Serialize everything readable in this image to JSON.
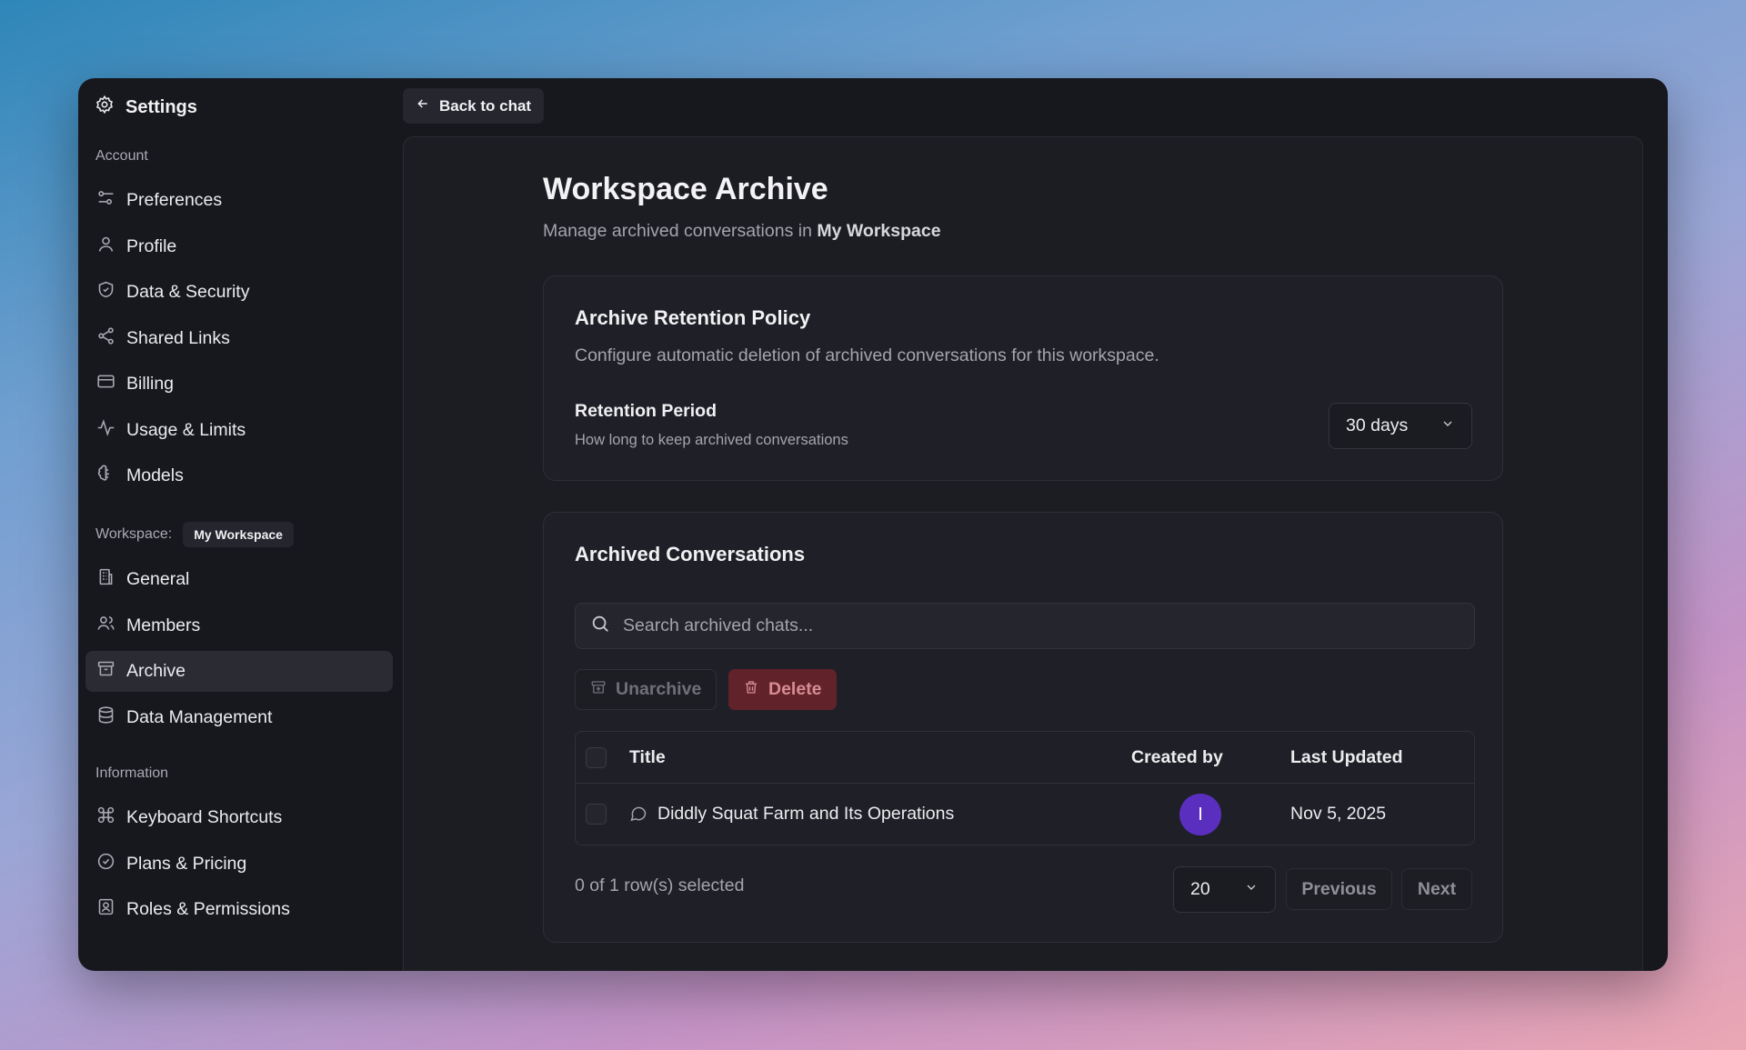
{
  "sidebar": {
    "title": "Settings",
    "sections": {
      "account": "Account",
      "workspace_label": "Workspace:",
      "workspace_badge": "My Workspace",
      "information": "Information"
    },
    "account_items": [
      {
        "label": "Preferences",
        "icon": "sliders-icon"
      },
      {
        "label": "Profile",
        "icon": "user-icon"
      },
      {
        "label": "Data & Security",
        "icon": "shield-icon"
      },
      {
        "label": "Shared Links",
        "icon": "share-icon"
      },
      {
        "label": "Billing",
        "icon": "credit-card-icon"
      },
      {
        "label": "Usage & Limits",
        "icon": "activity-icon"
      },
      {
        "label": "Models",
        "icon": "brain-icon"
      }
    ],
    "workspace_items": [
      {
        "label": "General",
        "icon": "building-icon"
      },
      {
        "label": "Members",
        "icon": "users-icon"
      },
      {
        "label": "Archive",
        "icon": "archive-icon",
        "active": true
      },
      {
        "label": "Data Management",
        "icon": "database-icon"
      }
    ],
    "information_items": [
      {
        "label": "Keyboard Shortcuts",
        "icon": "command-icon"
      },
      {
        "label": "Plans & Pricing",
        "icon": "badge-check-icon"
      },
      {
        "label": "Roles & Permissions",
        "icon": "id-badge-icon"
      }
    ]
  },
  "header": {
    "back_label": "Back to chat"
  },
  "page": {
    "title": "Workspace Archive",
    "subtitle_prefix": "Manage archived conversations in ",
    "subtitle_workspace": "My Workspace"
  },
  "retention": {
    "title": "Archive Retention Policy",
    "description": "Configure automatic deletion of archived conversations for this workspace.",
    "period_label": "Retention Period",
    "period_help": "How long to keep archived conversations",
    "period_value": "30 days"
  },
  "archived": {
    "title": "Archived Conversations",
    "search_placeholder": "Search archived chats...",
    "unarchive_label": "Unarchive",
    "delete_label": "Delete",
    "columns": {
      "title": "Title",
      "created_by": "Created by",
      "last_updated": "Last Updated"
    },
    "rows": [
      {
        "title": "Diddly Squat Farm and Its Operations",
        "creator_initial": "I",
        "last_updated": "Nov 5, 2025"
      }
    ],
    "selection_status": "0 of 1 row(s) selected",
    "page_size": "20",
    "previous_label": "Previous",
    "next_label": "Next"
  },
  "colors": {
    "accent_avatar": "#5a2fc0",
    "danger": "#7a2329",
    "danger_text": "#e49a9e"
  }
}
